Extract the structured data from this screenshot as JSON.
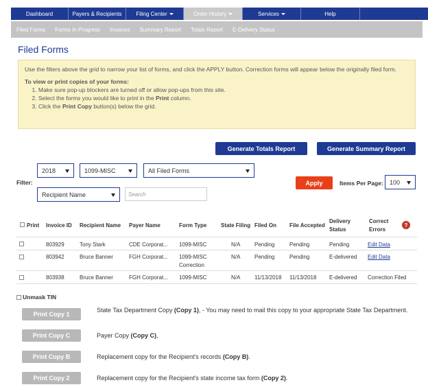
{
  "nav": {
    "items": [
      {
        "label": "Dashboard",
        "caret": false
      },
      {
        "label": "Payers & Recipients",
        "caret": false
      },
      {
        "label": "Filing Center",
        "caret": true
      },
      {
        "label": "Order History",
        "caret": true
      },
      {
        "label": "Services",
        "caret": true
      },
      {
        "label": "Help",
        "caret": false
      }
    ]
  },
  "subnav": [
    "Filed Forms",
    "Forms In Progress",
    "Invoices",
    "Summary Report",
    "Totals Report",
    "E-Delivery Status"
  ],
  "page_title": "Filed Forms",
  "notice": {
    "line1": "Use the filters above the grid to narrow your list of forms, and click the APPLY button. Correction forms will appear below the originally filed form.",
    "heading": "To view or print copies of your forms:",
    "step1": "Make sure pop-up blockers are turned off or allow pop-ups from this site.",
    "step2_pre": "Select the forms you would like to print in the ",
    "step2_bold": "Print",
    "step2_post": " column.",
    "step3_pre": "Click the ",
    "step3_bold": "Print Copy",
    "step3_post": " button(s) below the grid."
  },
  "buttons": {
    "totals": "Generate Totals Report",
    "summary": "Generate Summary Report",
    "apply": "Apply"
  },
  "filters": {
    "label": "Filter:",
    "year": "2018",
    "form": "1099-MISC",
    "status": "All Filed Forms",
    "sort": "Recipient Name",
    "search_placeholder": "Search",
    "items_per_page_label": "Items Per Page:",
    "items_per_page": "100"
  },
  "table": {
    "headers": {
      "print": "Print",
      "invoice": "Invoice ID",
      "recipient": "Recipient Name",
      "payer": "Payer Name",
      "form_type": "Form Type",
      "state_filing": "State Filing",
      "filed_on": "Filed On",
      "file_accepted": "File Accepted",
      "delivery1": "Delivery",
      "delivery2": "Status",
      "correct1": "Correct",
      "correct2": "Errors"
    },
    "rows": [
      {
        "invoice": "803929",
        "recipient": "Tony Stark",
        "payer": "CDE Corporat...",
        "form_type": "1099-MISC",
        "form_type2": "",
        "state": "N/A",
        "filed_on": "Pending",
        "accepted": "Pending",
        "delivery": "Pending",
        "correct": "Edit Data"
      },
      {
        "invoice": "803942",
        "recipient": "Bruce Banner",
        "payer": "FGH Corporat...",
        "form_type": "1099-MISC",
        "form_type2": "Correction",
        "state": "N/A",
        "filed_on": "Pending",
        "accepted": "Pending",
        "delivery": "E-delivered",
        "correct": "Edit Data"
      },
      {
        "invoice": "803938",
        "recipient": "Bruce Banner",
        "payer": "FGH Corporat...",
        "form_type": "1099-MISC",
        "form_type2": "",
        "state": "N/A",
        "filed_on": "11/13/2018",
        "accepted": "11/13/2018",
        "delivery": "E-delivered",
        "correct": "Correction Filed"
      }
    ]
  },
  "unmask": "Unmask TIN",
  "print_copies": [
    {
      "button": "Print Copy 1",
      "pre": "State Tax Department Copy ",
      "bold": "(Copy 1)",
      "post": ", - You may need to mail this copy to your appropriate State Tax Department."
    },
    {
      "button": "Print Copy C",
      "pre": "Payer Copy ",
      "bold": "(Copy C)",
      "post": ","
    },
    {
      "button": "Print Copy B",
      "pre": "Replacement copy for the Recipient's records ",
      "bold": "(Copy B)",
      "post": "."
    },
    {
      "button": "Print Copy 2",
      "pre": "Replacement copy for the Recipient's state income tax form ",
      "bold": "(Copy 2)",
      "post": "."
    }
  ],
  "colors": {
    "navy": "#1f3a93",
    "apply": "#e8411a",
    "notice_bg": "#fbf3c8"
  }
}
